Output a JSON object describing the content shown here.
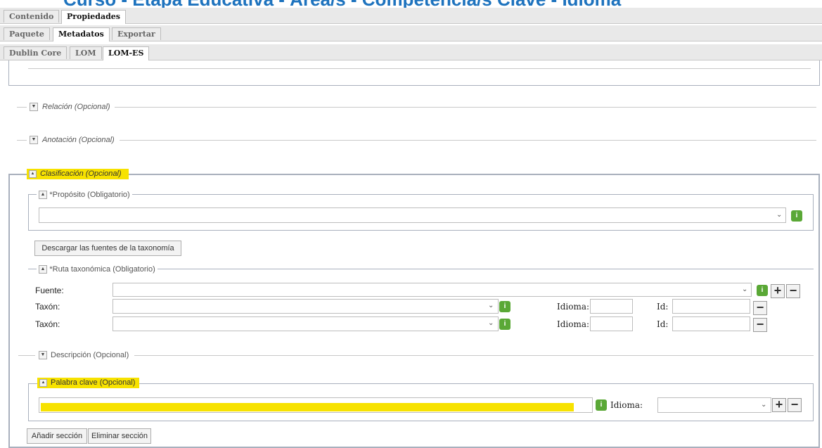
{
  "banner": "Curso - Etapa Educativa - Área/s - Competencia/s Clave - Idioma",
  "tabs_top": [
    "Contenido",
    "Propiedades"
  ],
  "tabs_mid": [
    "Paquete",
    "Metadatos",
    "Exportar"
  ],
  "tabs_sub": [
    "Dublin Core",
    "LOM",
    "LOM-ES"
  ],
  "sections": {
    "relacion": "Relación (Opcional)",
    "anotacion": "Anotación (Opcional)",
    "clasificacion": "Clasificación (Opcional)"
  },
  "proposito": {
    "legend": "*Propósito (Obligatorio)",
    "value": ""
  },
  "download_button": "Descargar las fuentes de la taxonomía",
  "ruta": {
    "legend": "*Ruta taxonómica (Obligatorio)",
    "fuente_label": "Fuente:",
    "taxon_label": "Taxón:",
    "idioma_label": "Idioma:",
    "id_label": "Id:"
  },
  "descripcion": {
    "legend": "Descripción (Opcional)"
  },
  "palabra_clave": {
    "legend": "Palabra clave (Opcional)",
    "idioma_label": "Idioma:",
    "value": ""
  },
  "footer_buttons": {
    "add": "Añadir sección",
    "remove": "Eliminar sección"
  },
  "icons": {
    "info": "i",
    "plus": "+",
    "minus": "−",
    "collapse": "▲",
    "expand": "▼",
    "select": "⌄"
  },
  "colors": {
    "highlight": "#f7e200",
    "info_green": "#5aa836",
    "banner_blue": "#1e73be"
  }
}
